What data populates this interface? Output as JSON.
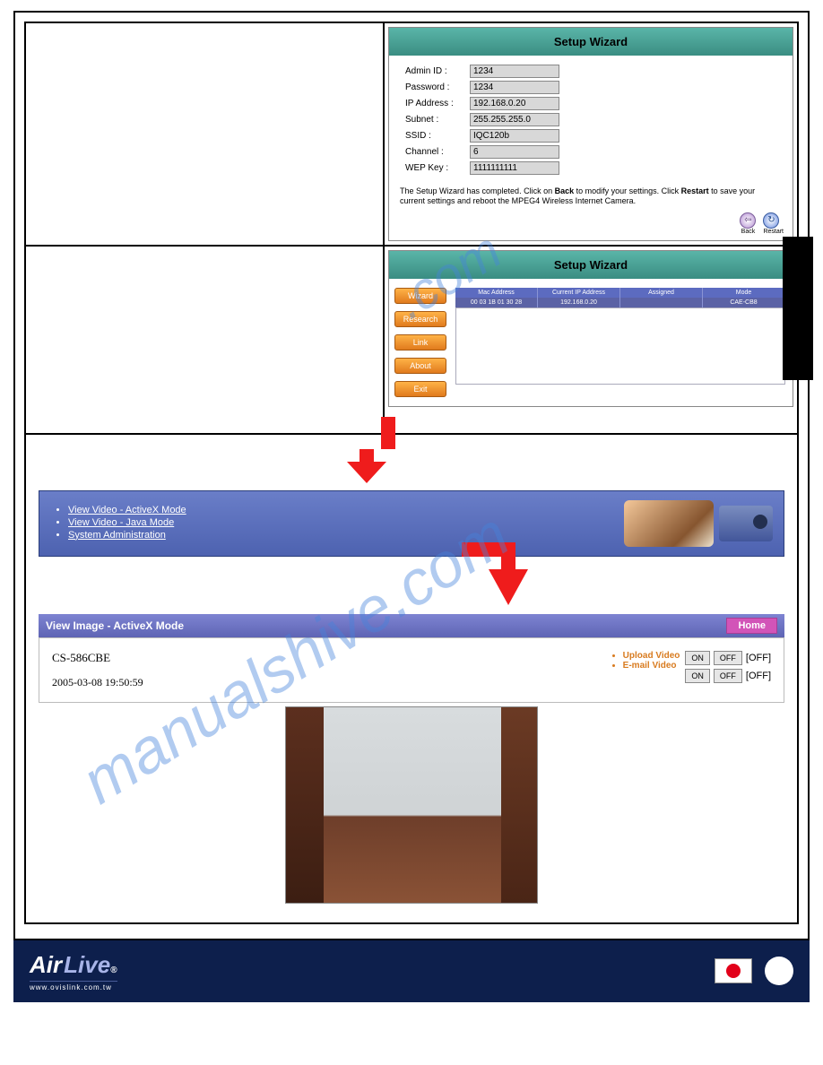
{
  "wizard1": {
    "title": "Setup Wizard",
    "fields": {
      "admin_id_label": "Admin ID :",
      "admin_id": "1234",
      "password_label": "Password :",
      "password": "1234",
      "ip_label": "IP Address :",
      "ip": "192.168.0.20",
      "subnet_label": "Subnet :",
      "subnet": "255.255.255.0",
      "ssid_label": "SSID :",
      "ssid": "IQC120b",
      "channel_label": "Channel :",
      "channel": "6",
      "wep_label": "WEP Key :",
      "wep": "1111111111"
    },
    "note_a": "The Setup Wizard has completed.  Click on ",
    "note_back": "Back",
    "note_b": " to modify your settings.  Click ",
    "note_restart": "Restart",
    "note_c": " to save your current settings and reboot the MPEG4 Wireless Internet Camera.",
    "back_btn": "Back",
    "restart_btn": "Restart"
  },
  "wizard2": {
    "title": "Setup Wizard",
    "side": [
      "Wizard",
      "Research",
      "Link",
      "About",
      "Exit"
    ],
    "headers": [
      "Mac Address",
      "Current IP Address",
      "Assigned",
      "Mode"
    ],
    "row": [
      "00 03 1B 01 30 28",
      "192.168.0.20",
      "",
      "CAE-CB8"
    ]
  },
  "nav": {
    "links": [
      "View Video - ActiveX Mode",
      "View Video - Java Mode",
      "System Administration"
    ]
  },
  "view": {
    "bar_title": "View Image - ActiveX Mode",
    "home": "Home",
    "camera": "CS-586CBE",
    "timestamp": "2005-03-08 19:50:59",
    "upload_link": "Upload Video",
    "email_link": "E-mail Video",
    "on": "ON",
    "off": "OFF",
    "state_off": "[OFF]"
  },
  "footer": {
    "brand_a": "Air",
    "brand_b": "Live",
    "url": "www.ovislink.com.tw"
  },
  "watermark": "manualshive.com"
}
